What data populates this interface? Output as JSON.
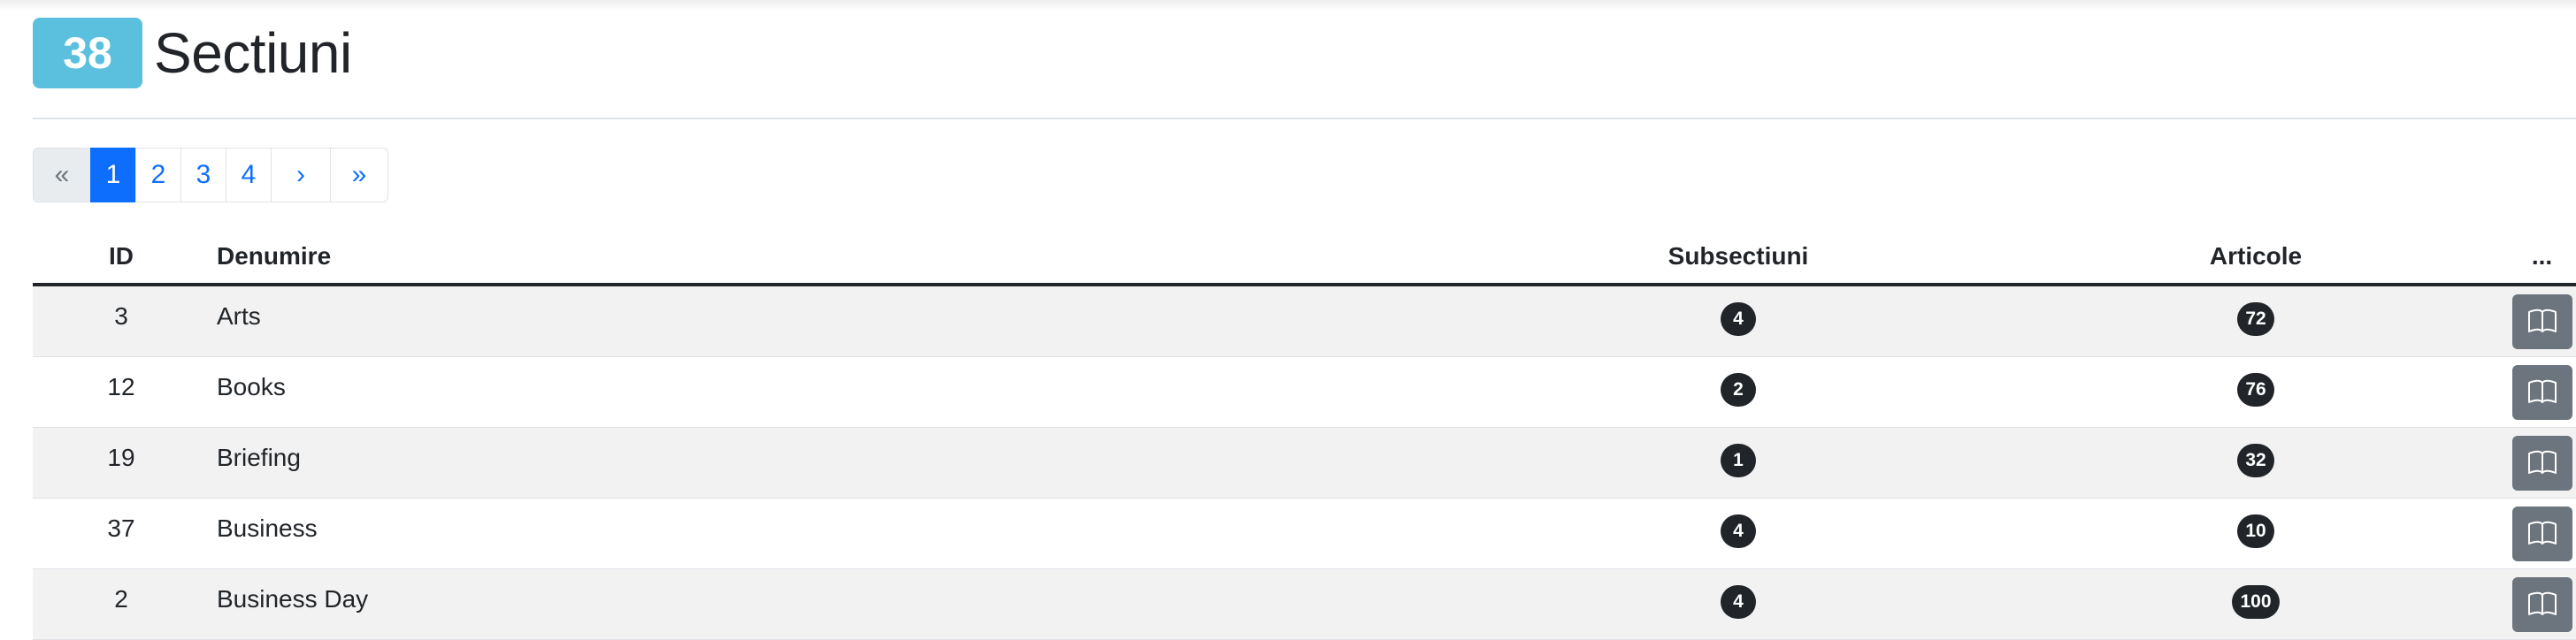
{
  "header": {
    "count": "38",
    "title": "Sectiuni"
  },
  "pagination": {
    "first": "«",
    "pages": [
      "1",
      "2",
      "3",
      "4"
    ],
    "active_page": "1",
    "next": "›",
    "last": "»"
  },
  "table": {
    "columns": {
      "id": "ID",
      "name": "Denumire",
      "subsections": "Subsectiuni",
      "articles": "Articole",
      "actions": "..."
    },
    "rows": [
      {
        "id": "3",
        "name": "Arts",
        "subsections": "4",
        "articles": "72",
        "action_icon": "book-open-icon"
      },
      {
        "id": "12",
        "name": "Books",
        "subsections": "2",
        "articles": "76",
        "action_icon": "book-open-icon"
      },
      {
        "id": "19",
        "name": "Briefing",
        "subsections": "1",
        "articles": "32",
        "action_icon": "book-open-icon"
      },
      {
        "id": "37",
        "name": "Business",
        "subsections": "4",
        "articles": "10",
        "action_icon": "book-open-icon"
      },
      {
        "id": "2",
        "name": "Business Day",
        "subsections": "4",
        "articles": "100",
        "action_icon": "book-open-icon"
      }
    ]
  },
  "colors": {
    "count_badge": "#5bc0de",
    "active_page": "#0d6efd",
    "pill": "#212529",
    "action_button": "#6c757d",
    "striped_row": "#f2f2f2"
  }
}
